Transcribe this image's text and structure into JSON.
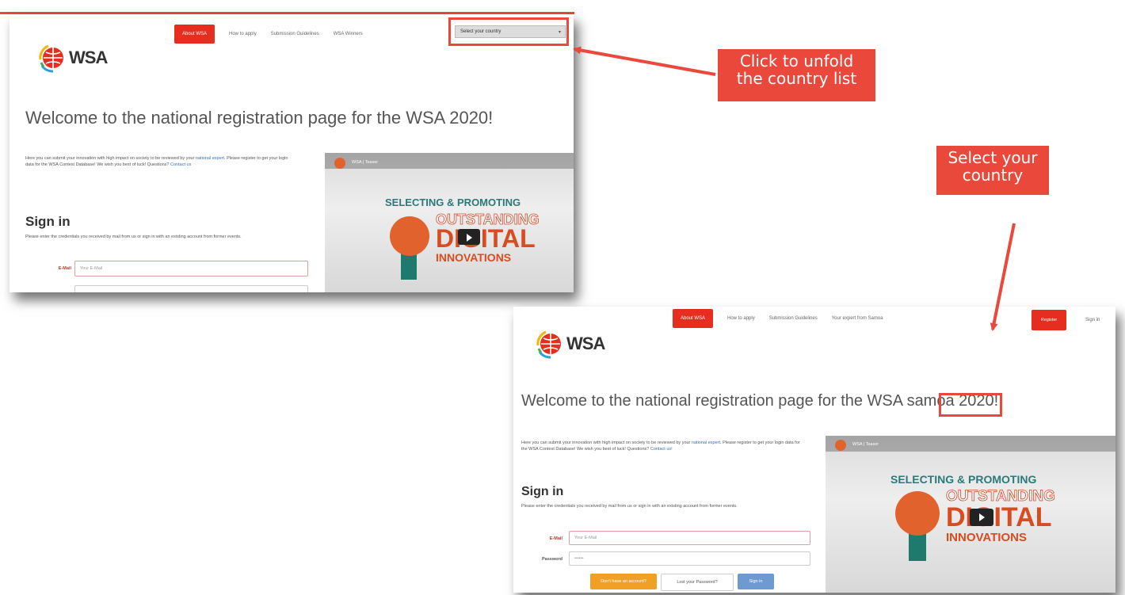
{
  "colors": {
    "accent": "#e9483b",
    "nav_active": "#e52e1f",
    "link": "#3b6fb6"
  },
  "screenshot_a": {
    "logo": "WSA",
    "nav": [
      "About WSA",
      "How to apply",
      "Submission Guidelines",
      "WSA Winners"
    ],
    "country_select": "Select your country",
    "welcome": "Welcome to the national registration page for the WSA 2020!",
    "intro": {
      "part1": "Here you can submit your innovation with high impact on society to be reviewed by your ",
      "link1": "national expert",
      "part2": ". Please register to get your login data for the WSA Contest Database! We wish you best of luck! Questions? ",
      "link2": "Contact us"
    },
    "signin_title": "Sign in",
    "signin_desc": "Please enter the credentials you received by mail from us or sign in with an existing account from former events.",
    "email_label": "E-Mail",
    "email_placeholder": "Your E-Mail",
    "video": {
      "title": "WSA | Teaser",
      "line1": "SELECTING & PROMOTING",
      "line2": "OUTSTANDING",
      "line3": "DIGITAL",
      "line4": "INNOVATIONS"
    }
  },
  "screenshot_b": {
    "logo": "WSA",
    "nav": [
      "About WSA",
      "How to apply",
      "Submission Guidelines",
      "Your expert from Samoa"
    ],
    "register": "Register",
    "signin_link": "Sign in",
    "welcome_pre": "Welcome to the national registration page for the WSA ",
    "welcome_country": "samoa",
    "welcome_post": " 2020!",
    "intro": {
      "part1": "Here you can submit your innovation with high impact on society to be reviewed by your ",
      "link1": "national expert",
      "part2": ". Please register to get your login data for the WSA Contest Database! We wish you best of luck! Questions? ",
      "link2": "Contact us!"
    },
    "signin_title": "Sign in",
    "signin_desc": "Please enter the credentials you received by mail from us or sign in with an existing account from former events.",
    "email_label": "E-Mail",
    "email_placeholder": "Your E-Mail",
    "password_label": "Password",
    "password_value": "••••••",
    "btn_no_account": "Don't have an account?",
    "btn_lost": "Lost your Password?",
    "btn_signin": "Sign in",
    "video": {
      "title": "WSA | Teaser",
      "line1": "SELECTING & PROMOTING",
      "line2": "OUTSTANDING",
      "line3": "DIGITAL",
      "line4": "INNOVATIONS"
    }
  },
  "callouts": {
    "unfold": [
      "Click to unfold",
      "the country list"
    ],
    "select": [
      "Select your",
      "country"
    ]
  }
}
